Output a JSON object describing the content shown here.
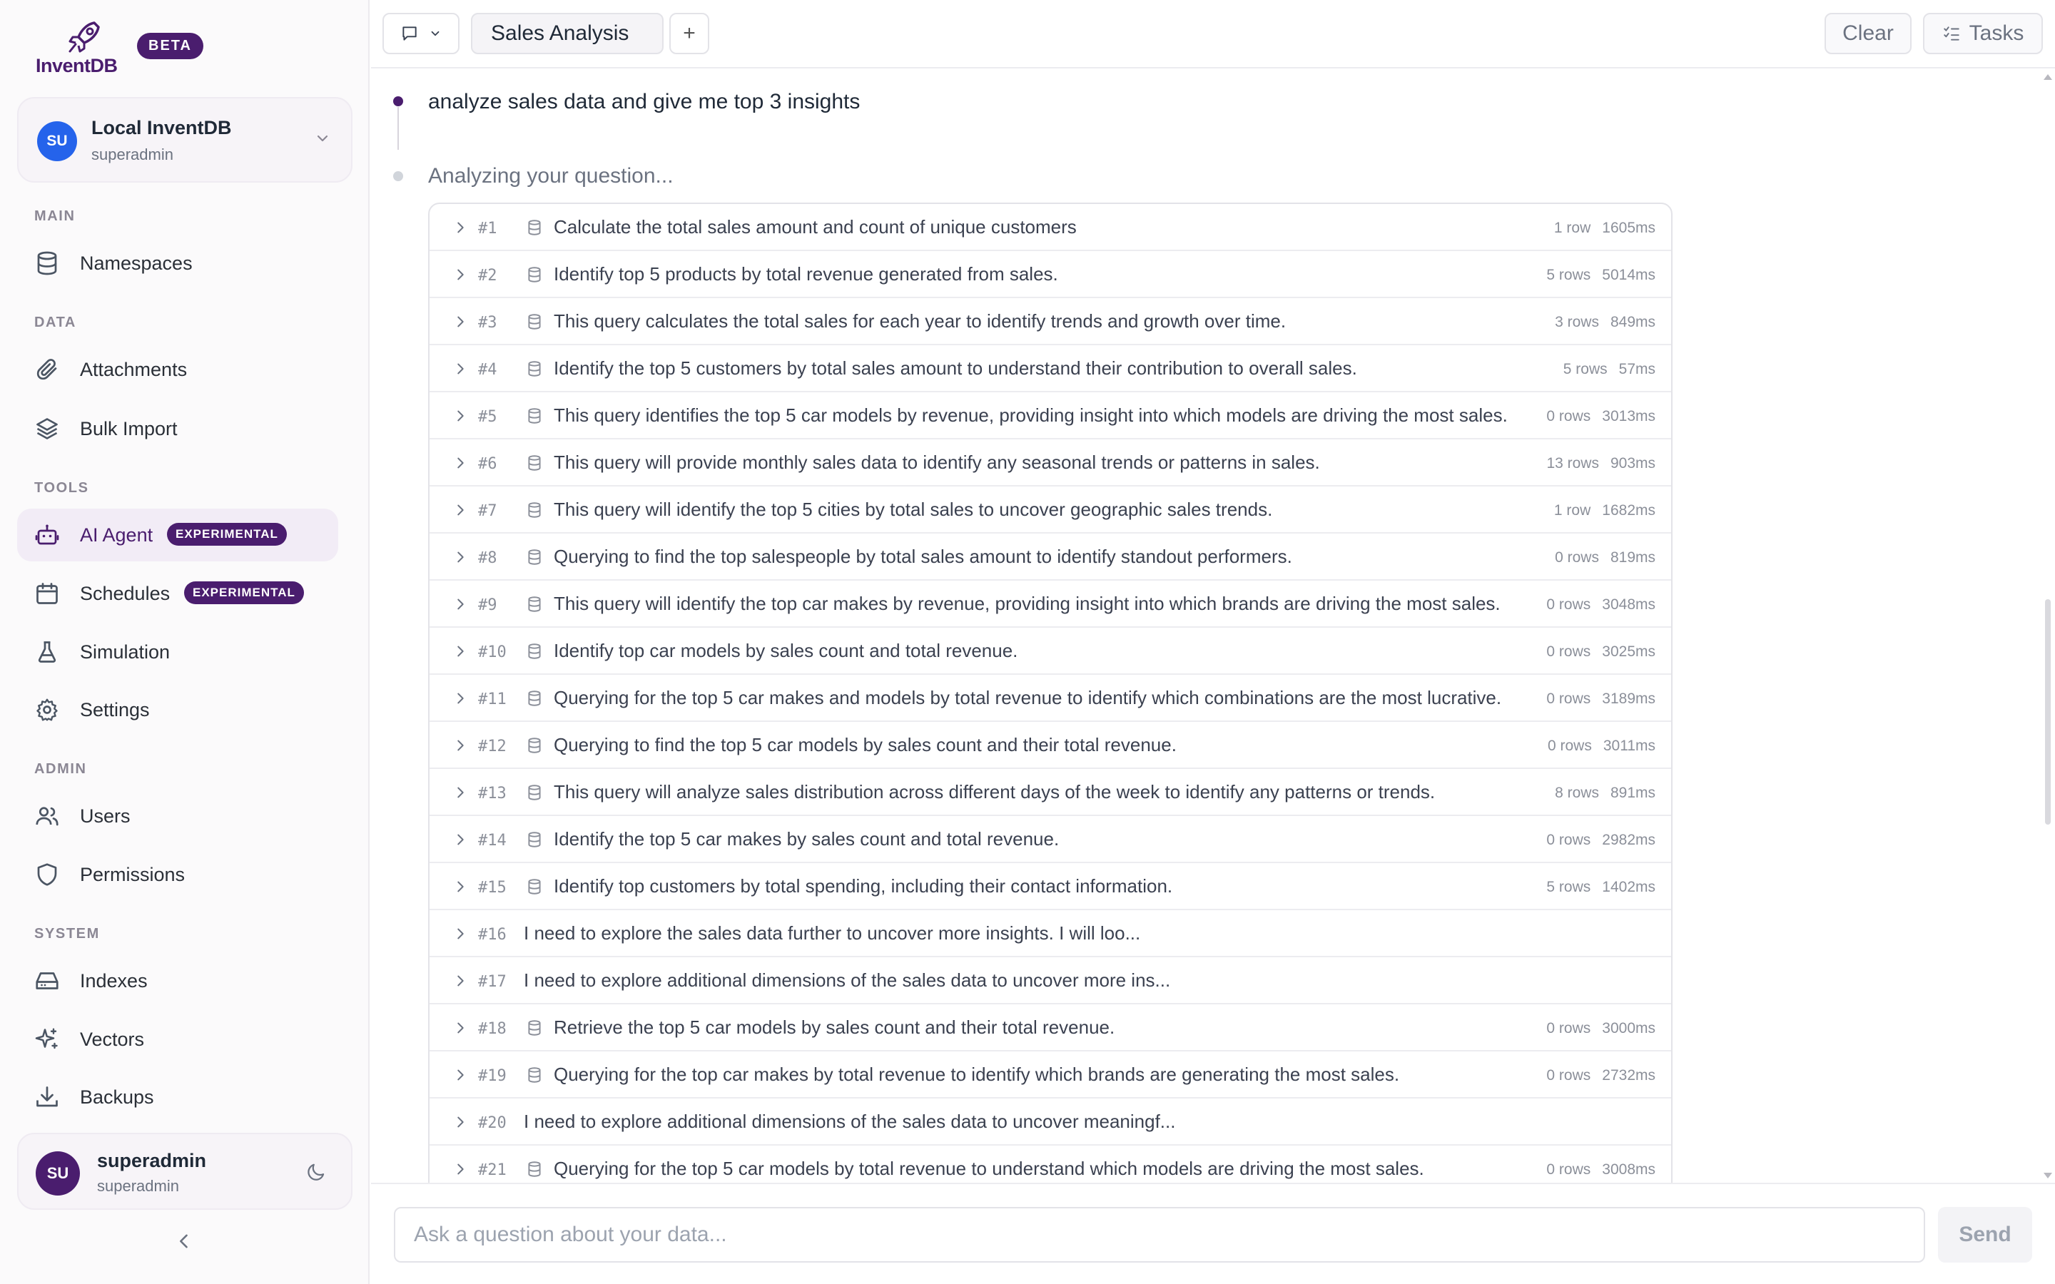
{
  "app": {
    "logo_text": "InventDB",
    "beta_label": "BETA"
  },
  "db_selector": {
    "avatar": "SU",
    "name": "Local InventDB",
    "user": "superadmin"
  },
  "sections": {
    "main": "MAIN",
    "data": "DATA",
    "tools": "TOOLS",
    "admin": "ADMIN",
    "system": "SYSTEM"
  },
  "nav": {
    "namespaces": "Namespaces",
    "attachments": "Attachments",
    "bulk_import": "Bulk Import",
    "ai_agent": "AI Agent",
    "schedules": "Schedules",
    "simulation": "Simulation",
    "settings": "Settings",
    "users": "Users",
    "permissions": "Permissions",
    "indexes": "Indexes",
    "vectors": "Vectors",
    "backups": "Backups",
    "experimental_badge": "EXPERIMENTAL",
    "active": "ai_agent"
  },
  "user_card": {
    "avatar": "SU",
    "name": "superadmin",
    "sub": "superadmin"
  },
  "topbar": {
    "tab_title": "Sales Analysis",
    "add_label": "+",
    "clear_label": "Clear",
    "tasks_label": "Tasks"
  },
  "conversation": {
    "question": "analyze sales data and give me top 3 insights",
    "status": "Analyzing your question..."
  },
  "steps": [
    {
      "num": "#1",
      "text": "Calculate the total sales amount and count of unique customers",
      "rows": "1 row",
      "ms": "1605ms",
      "query": true
    },
    {
      "num": "#2",
      "text": "Identify top 5 products by total revenue generated from sales.",
      "rows": "5 rows",
      "ms": "5014ms",
      "query": true
    },
    {
      "num": "#3",
      "text": "This query calculates the total sales for each year to identify trends and growth over time.",
      "rows": "3 rows",
      "ms": "849ms",
      "query": true
    },
    {
      "num": "#4",
      "text": "Identify the top 5 customers by total sales amount to understand their contribution to overall sales.",
      "rows": "5 rows",
      "ms": "57ms",
      "query": true
    },
    {
      "num": "#5",
      "text": "This query identifies the top 5 car models by revenue, providing insight into which models are driving the most sales.",
      "rows": "0 rows",
      "ms": "3013ms",
      "query": true
    },
    {
      "num": "#6",
      "text": "This query will provide monthly sales data to identify any seasonal trends or patterns in sales.",
      "rows": "13 rows",
      "ms": "903ms",
      "query": true
    },
    {
      "num": "#7",
      "text": "This query will identify the top 5 cities by total sales to uncover geographic sales trends.",
      "rows": "1 row",
      "ms": "1682ms",
      "query": true
    },
    {
      "num": "#8",
      "text": "Querying to find the top salespeople by total sales amount to identify standout performers.",
      "rows": "0 rows",
      "ms": "819ms",
      "query": true
    },
    {
      "num": "#9",
      "text": "This query will identify the top car makes by revenue, providing insight into which brands are driving the most sales.",
      "rows": "0 rows",
      "ms": "3048ms",
      "query": true
    },
    {
      "num": "#10",
      "text": "Identify top car models by sales count and total revenue.",
      "rows": "0 rows",
      "ms": "3025ms",
      "query": true
    },
    {
      "num": "#11",
      "text": "Querying for the top 5 car makes and models by total revenue to identify which combinations are the most lucrative.",
      "rows": "0 rows",
      "ms": "3189ms",
      "query": true
    },
    {
      "num": "#12",
      "text": "Querying to find the top 5 car models by sales count and their total revenue.",
      "rows": "0 rows",
      "ms": "3011ms",
      "query": true
    },
    {
      "num": "#13",
      "text": "This query will analyze sales distribution across different days of the week to identify any patterns or trends.",
      "rows": "8 rows",
      "ms": "891ms",
      "query": true
    },
    {
      "num": "#14",
      "text": "Identify the top 5 car makes by sales count and total revenue.",
      "rows": "0 rows",
      "ms": "2982ms",
      "query": true
    },
    {
      "num": "#15",
      "text": "Identify top customers by total spending, including their contact information.",
      "rows": "5 rows",
      "ms": "1402ms",
      "query": true
    },
    {
      "num": "#16",
      "text": "I need to explore the sales data further to uncover more insights. I will loo...",
      "rows": "",
      "ms": "",
      "query": false
    },
    {
      "num": "#17",
      "text": "I need to explore additional dimensions of the sales data to uncover more ins...",
      "rows": "",
      "ms": "",
      "query": false
    },
    {
      "num": "#18",
      "text": "Retrieve the top 5 car models by sales count and their total revenue.",
      "rows": "0 rows",
      "ms": "3000ms",
      "query": true
    },
    {
      "num": "#19",
      "text": "Querying for the top car makes by total revenue to identify which brands are generating the most sales.",
      "rows": "0 rows",
      "ms": "2732ms",
      "query": true
    },
    {
      "num": "#20",
      "text": "I need to explore additional dimensions of the sales data to uncover meaningf...",
      "rows": "",
      "ms": "",
      "query": false
    },
    {
      "num": "#21",
      "text": "Querying for the top 5 car models by total revenue to understand which models are driving the most sales.",
      "rows": "0 rows",
      "ms": "3008ms",
      "query": true
    }
  ],
  "composer": {
    "placeholder": "Ask a question about your data...",
    "send_label": "Send"
  },
  "colors": {
    "brand": "#4a1d6e",
    "db_avatar": "#2563eb",
    "active_nav_bg": "#f2ecf6"
  }
}
